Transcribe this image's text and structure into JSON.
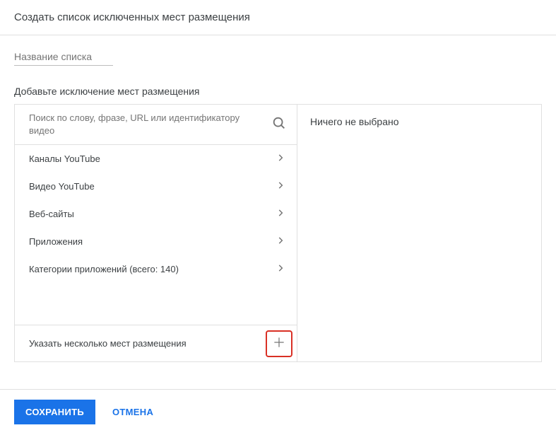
{
  "header": {
    "title": "Создать список исключенных мест размещения"
  },
  "name_input": {
    "placeholder": "Название списка"
  },
  "section": {
    "label": "Добавьте исключение мест размещения"
  },
  "search": {
    "placeholder": "Поиск по слову, фразе, URL или идентификатору видео"
  },
  "categories": [
    {
      "label": "Каналы YouTube"
    },
    {
      "label": "Видео YouTube"
    },
    {
      "label": "Веб-сайты"
    },
    {
      "label": "Приложения"
    },
    {
      "label": "Категории приложений (всего: 140)"
    }
  ],
  "multi_add": {
    "label": "Указать несколько мест размещения"
  },
  "right_panel": {
    "empty_text": "Ничего не выбрано"
  },
  "footer": {
    "save": "СОХРАНИТЬ",
    "cancel": "ОТМЕНА"
  }
}
